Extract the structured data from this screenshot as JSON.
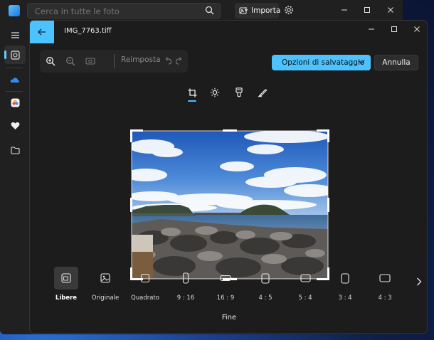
{
  "search": {
    "placeholder": "Cerca in tutte le foto"
  },
  "topbar": {
    "import_label": "Importa"
  },
  "editor": {
    "file_name": "IMG_7763.tiff",
    "reset_label": "Reimposta",
    "save_options_label": "Opzioni di salvataggio",
    "cancel_label": "Annulla",
    "done_label": "Fine"
  },
  "ratios": [
    {
      "label": "Libere",
      "selected": true
    },
    {
      "label": "Originale"
    },
    {
      "label": "Quadrato"
    },
    {
      "label": "9 : 16"
    },
    {
      "label": "16 : 9"
    },
    {
      "label": "4 : 5"
    },
    {
      "label": "5 : 4"
    },
    {
      "label": "3 : 4"
    },
    {
      "label": "4 : 3"
    }
  ],
  "colors": {
    "accent": "#4cc2ff",
    "background": "#1c1c1c",
    "panel": "#262626"
  }
}
